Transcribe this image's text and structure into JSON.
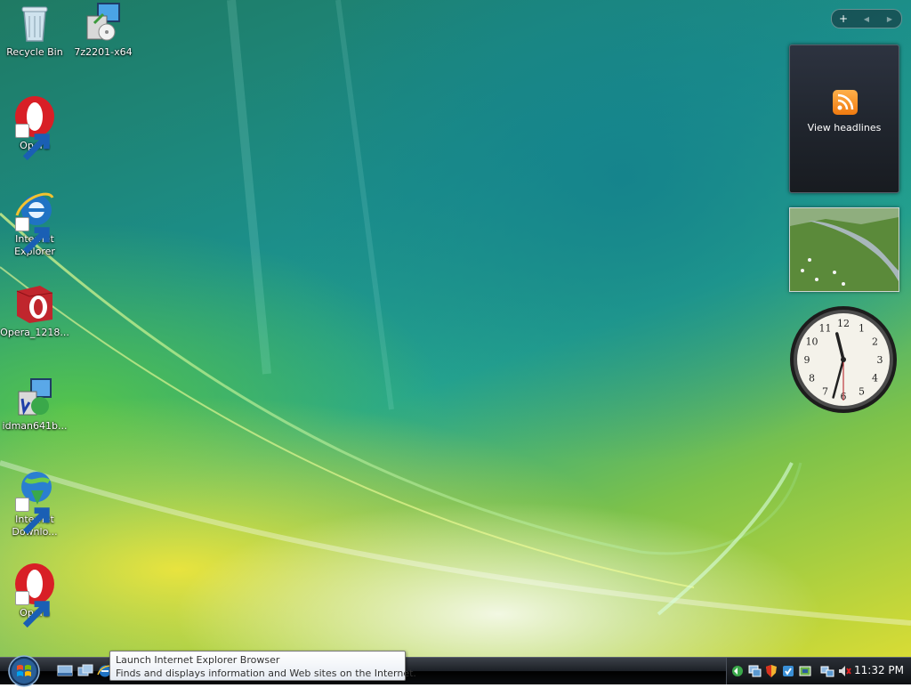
{
  "desktop": {
    "icons": [
      {
        "label": "Recycle Bin",
        "icon": "recycle-bin-icon"
      },
      {
        "label": "7z2201-x64",
        "icon": "installer-icon"
      },
      {
        "label": "Opera",
        "icon": "opera-icon"
      },
      {
        "label": "Internet Explorer",
        "icon": "internet-explorer-icon"
      },
      {
        "label": "Opera_1218...",
        "icon": "opera-installer-icon"
      },
      {
        "label": "idman641b...",
        "icon": "idm-installer-icon"
      },
      {
        "label": "Internet Downlo...",
        "icon": "internet-download-manager-icon"
      },
      {
        "label": "Opera",
        "icon": "opera-icon"
      }
    ]
  },
  "sidebar": {
    "add_symbol": "+",
    "prev_symbol": "◀",
    "next_symbol": "▶",
    "feed_gadget": {
      "label": "View headlines",
      "icon": "rss-icon"
    },
    "photo_gadget": {
      "icon": "slideshow-photo"
    },
    "clock_gadget": {
      "numbers": [
        "12",
        "1",
        "2",
        "3",
        "4",
        "5",
        "6",
        "7",
        "8",
        "9",
        "10",
        "11"
      ],
      "hour": 11,
      "minute": 32,
      "second": 30
    }
  },
  "tooltip": {
    "title": "Launch Internet Explorer Browser",
    "description": "Finds and displays information and Web sites on the Internet."
  },
  "taskbar": {
    "quick_launch": [
      "show-desktop-icon",
      "switch-windows-icon",
      "internet-explorer-icon"
    ],
    "tray_icons": [
      "network-sync-icon",
      "network-icon",
      "security-shield-icon",
      "antivirus-icon",
      "device-icon",
      "network-connection-icon",
      "volume-muted-icon"
    ],
    "clock": "11:32 PM"
  },
  "colors": {
    "desktop_teal": "#1c8f8a",
    "desktop_yellow": "#d8dc35",
    "taskbar": "#1b1f25",
    "opera_red": "#d81f26",
    "ie_blue": "#1f73c4"
  }
}
